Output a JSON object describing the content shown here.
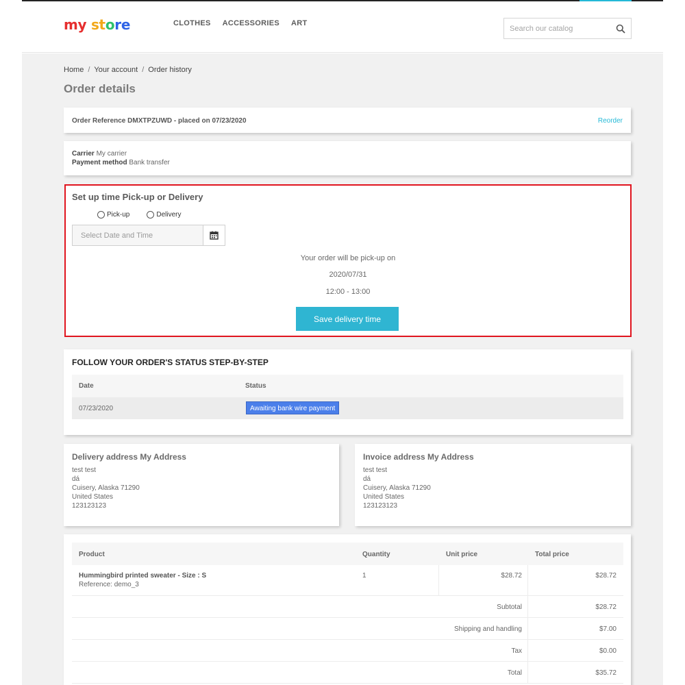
{
  "header": {
    "logo": {
      "part1": "my",
      "part2": " ",
      "part3": "st",
      "part4": "o",
      "part5": "re"
    },
    "nav": [
      "CLOTHES",
      "ACCESSORIES",
      "ART"
    ],
    "search_placeholder": "Search our catalog"
  },
  "breadcrumb": {
    "home": "Home",
    "sep": "/",
    "account": "Your account",
    "history": "Order history"
  },
  "page_title": "Order details",
  "order": {
    "reference_text": "Order Reference DMXTPZUWD - placed on 07/23/2020",
    "reorder": "Reorder",
    "carrier_label": "Carrier",
    "carrier_value": "My carrier",
    "payment_label": "Payment method",
    "payment_value": "Bank transfer"
  },
  "delivery": {
    "title": "Set up time Pick-up or Delivery",
    "option_pickup": "Pick-up",
    "option_delivery": "Delivery",
    "date_placeholder": "Select Date and Time",
    "message": "Your order will be pick-up on",
    "date": "2020/07/31",
    "time": "12:00 - 13:00",
    "save_label": "Save delivery time"
  },
  "status": {
    "title": "FOLLOW YOUR ORDER'S STATUS STEP-BY-STEP",
    "col_date": "Date",
    "col_status": "Status",
    "rows": [
      {
        "date": "07/23/2020",
        "status": "Awaiting bank wire payment",
        "color": "#4b7fea"
      }
    ]
  },
  "addresses": {
    "delivery": {
      "title": "Delivery address My Address",
      "lines": [
        "test test",
        "dá",
        "Cuisery, Alaska 71290",
        "United States",
        "123123123"
      ]
    },
    "invoice": {
      "title": "Invoice address My Address",
      "lines": [
        "test test",
        "dá",
        "Cuisery, Alaska 71290",
        "United States",
        "123123123"
      ]
    }
  },
  "products": {
    "col_product": "Product",
    "col_quantity": "Quantity",
    "col_unit_price": "Unit price",
    "col_total_price": "Total price",
    "item": {
      "name": "Hummingbird printed sweater - Size : S",
      "reference": "Reference: demo_3",
      "quantity": "1",
      "unit_price": "$28.72",
      "total_price": "$28.72"
    },
    "summary": [
      {
        "label": "Subtotal",
        "value": "$28.72"
      },
      {
        "label": "Shipping and handling",
        "value": "$7.00"
      },
      {
        "label": "Tax",
        "value": "$0.00"
      },
      {
        "label": "Total",
        "value": "$35.72"
      }
    ]
  },
  "colors": {
    "accent": "#2fb5d2",
    "highlight_border": "#e0141e",
    "badge": "#4b7fea"
  }
}
